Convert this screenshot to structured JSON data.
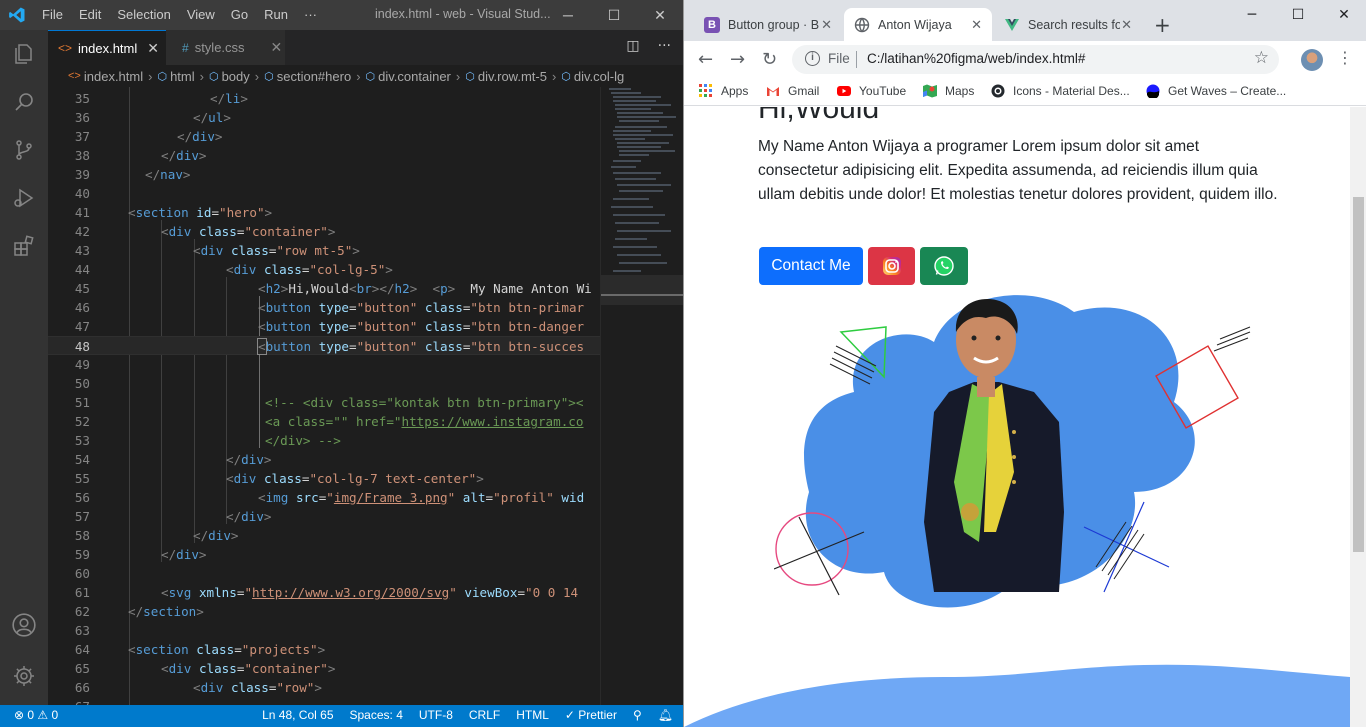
{
  "vscode": {
    "menu": [
      "File",
      "Edit",
      "Selection",
      "View",
      "Go",
      "Run",
      "···"
    ],
    "window_title": "index.html - web - Visual Stud...",
    "tabs": [
      {
        "label": "index.html",
        "icon": "<>"
      },
      {
        "label": "style.css",
        "icon": "#"
      }
    ],
    "breadcrumbs": [
      "index.html",
      "html",
      "body",
      "section#hero",
      "div.container",
      "div.row.mt-5",
      "div.col-lg"
    ],
    "line_numbers": [
      "35",
      "36",
      "37",
      "38",
      "39",
      "40",
      "41",
      "42",
      "43",
      "44",
      "45",
      "46",
      "47",
      "48",
      "49",
      "50",
      "51",
      "52",
      "53",
      "54",
      "55",
      "56",
      "57",
      "58",
      "59",
      "60",
      "61",
      "62",
      "63",
      "64",
      "65",
      "66",
      "67"
    ],
    "status": {
      "problems": "⊗ 0 ⚠ 0",
      "position": "Ln 48, Col 65",
      "spaces": "Spaces: 4",
      "encoding": "UTF-8",
      "eol": "CRLF",
      "language": "HTML",
      "formatter": "✓ Prettier"
    },
    "code": {
      "l35": "</li>",
      "l36": "</ul>",
      "l37": "</div>",
      "l38": "</div>",
      "l39": "</nav>",
      "l41_tag": "section",
      "l41_attr": "id",
      "l41_val": "\"hero\"",
      "l42_tag": "div",
      "l42_attr": "class",
      "l42_val": "\"container\"",
      "l43_tag": "div",
      "l43_attr": "class",
      "l43_val": "\"row mt-5\"",
      "l44_tag": "div",
      "l44_attr": "class",
      "l44_val": "\"col-lg-5\"",
      "l45_h2": "h2",
      "l45_text": "Hi,Would",
      "l45_br": "br",
      "l45_p": "p",
      "l45_ptext": "  My Name Anton Wi",
      "l46_tag": "button",
      "l46_attr1": "type",
      "l46_val1": "\"button\"",
      "l46_attr2": "class",
      "l46_val2": "\"btn btn-primar",
      "l47_tag": "button",
      "l47_attr1": "type",
      "l47_val1": "\"button\"",
      "l47_attr2": "class",
      "l47_val2": "\"btn btn-danger",
      "l48_tag": "button",
      "l48_attr1": "type",
      "l48_val1": "\"button\"",
      "l48_attr2": "class",
      "l48_val2": "\"btn btn-succes",
      "l51": "<!-- <div class=\"kontak btn btn-primary\"><",
      "l52_a": "<a class=\"\" href=\"",
      "l52_url": "https://www.instagram.co",
      "l53": "</div> -->",
      "l54": "</div>",
      "l55_tag": "div",
      "l55_attr": "class",
      "l55_val": "\"col-lg-7 text-center\"",
      "l56_tag": "img",
      "l56_attr1": "src",
      "l56_val1": "img/Frame 3.png",
      "l56_attr2": "alt",
      "l56_val2": "\"profil\"",
      "l56_attr3": "wid",
      "l57": "</div>",
      "l58": "</div>",
      "l59": "</div>",
      "l61_tag": "svg",
      "l61_attr1": "xmlns",
      "l61_url": "http://www.w3.org/2000/svg",
      "l61_attr2": "viewBox",
      "l61_val2": "\"0 0 14",
      "l62": "</section>",
      "l64_tag": "section",
      "l64_attr": "class",
      "l64_val": "\"projects\"",
      "l65_tag": "div",
      "l65_attr": "class",
      "l65_val": "\"container\"",
      "l66_tag": "div",
      "l66_attr": "class",
      "l66_val": "\"row\""
    }
  },
  "chrome": {
    "tabs": [
      {
        "label": "Button group · B",
        "favicon": "B",
        "favicon_color": "#7952b3"
      },
      {
        "label": "Anton Wijaya",
        "favicon": "globe-icon"
      },
      {
        "label": "Search results fo",
        "favicon": "vue-icon",
        "favicon_color": "#41b883"
      }
    ],
    "omnibox": {
      "scheme_label": "File",
      "url": "C:/latihan%20figma/web/index.html#"
    },
    "bookmarks": [
      "Apps",
      "Gmail",
      "YouTube",
      "Maps",
      "Icons - Material Des...",
      "Get Waves – Create..."
    ],
    "page": {
      "title": "Hi,Would",
      "paragraph": "My Name Anton Wijaya a programer Lorem ipsum dolor sit amet consectetur adipisicing elit. Expedita assumenda, ad reiciendis illum quia ullam debitis unde dolor! Et molestias tenetur dolores provident, quidem illo.",
      "contact_button": "Contact Me",
      "blob_color": "#4a8fe7",
      "wave_color": "#6fa8f5"
    }
  }
}
